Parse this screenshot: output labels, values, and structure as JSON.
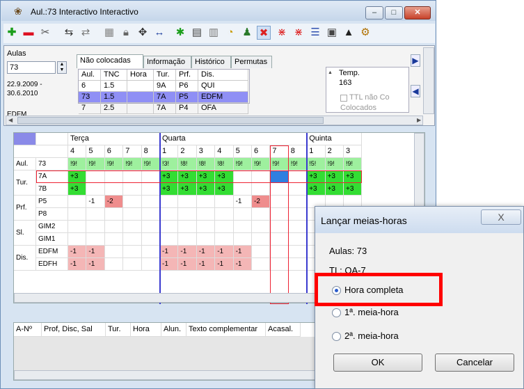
{
  "window": {
    "title": "Aul.:73 Interactivo Interactivo",
    "minimize": "–",
    "maximize": "□",
    "close": "✕"
  },
  "toolbar": {
    "icons": [
      "add-icon",
      "remove-icon",
      "cut-icon",
      "swap-icon",
      "exchange-icon",
      "grid-icon",
      "lock-icon",
      "move-icon",
      "arrows-icon",
      "magic-icon",
      "schedule-icon",
      "table-icon",
      "clock-icon",
      "person-icon",
      "delete-icon",
      "cross-icon",
      "cross2-icon",
      "list-icon",
      "calc-icon",
      "hat-icon",
      "settings-icon"
    ]
  },
  "left_panel": {
    "aulas_label": "Aulas",
    "aulas_value": "73",
    "date_range_1": "22.9.2009 -",
    "date_range_2": "30.6.2010",
    "cut_label": "EDFM"
  },
  "tabs": [
    "Não colocadas",
    "Informação",
    "Histórico",
    "Permutas"
  ],
  "mini_table": {
    "headers": [
      "Aul.",
      "TNC",
      "Hora",
      "Tur.",
      "Prf.",
      "Dis."
    ],
    "rows": [
      [
        "6",
        "1.5",
        "",
        "9A",
        "P6",
        "QUI"
      ],
      [
        "73",
        "1.5",
        "",
        "7A",
        "P5",
        "EDFM"
      ],
      [
        "7",
        "2.5",
        "",
        "7A",
        "P4",
        "OFA"
      ]
    ]
  },
  "right_panel": {
    "temp_label": "Temp.",
    "temp_value": "163",
    "ttl_label": "TTL não Co",
    "colocados": "Colocados"
  },
  "grid": {
    "days": [
      "Terça",
      "Quarta",
      "Quinta"
    ],
    "periods": {
      "terca": [
        "4",
        "5",
        "6",
        "7",
        "8"
      ],
      "quarta": [
        "1",
        "2",
        "3",
        "4",
        "5",
        "6",
        "7",
        "8"
      ],
      "quinta": [
        "1",
        "2",
        "3"
      ]
    },
    "aul_row": {
      "label": "Aul.",
      "value": "73",
      "terca": [
        "!9!",
        "!9!",
        "!9!",
        "!9!",
        "!9!"
      ],
      "quarta": [
        "!3!",
        "!8!",
        "!8!",
        "!8!",
        "!9!",
        "!9!",
        "!9!",
        "!9!"
      ],
      "quinta": [
        "!5!",
        "!9!",
        "!9!"
      ]
    },
    "tur": {
      "label": "Tur.",
      "r1": "7A",
      "r2": "7B",
      "plus": "+3"
    },
    "prf": {
      "label": "Prf.",
      "r1": "P5",
      "r2": "P8",
      "minus": "-1",
      "minus2": "-2"
    },
    "sl": {
      "label": "Sl.",
      "r1": "GIM2",
      "r2": "GIM1"
    },
    "dis": {
      "label": "Dis.",
      "r1": "EDFM",
      "r2": "EDFH",
      "minus": "-1"
    }
  },
  "bottom_table": {
    "headers": [
      "A-Nº",
      "Prof, Disc, Sal",
      "Tur.",
      "Hora",
      "Alun.",
      "Texto complementar",
      "Acasal."
    ]
  },
  "dialog": {
    "title": "Lançar meias-horas",
    "close": "X",
    "aulas": "Aulas: 73",
    "tl": "TL: OA-7",
    "options": [
      "Hora completa",
      "1ª. meia-hora",
      "2ª. meia-hora"
    ],
    "selected": "Hora completa",
    "ok": "OK",
    "cancel": "Cancelar"
  },
  "colors": {
    "highlight": "#ff0000",
    "green": "#33dd33",
    "pink": "#f4b6b6",
    "accent": "#3a3ad0"
  }
}
